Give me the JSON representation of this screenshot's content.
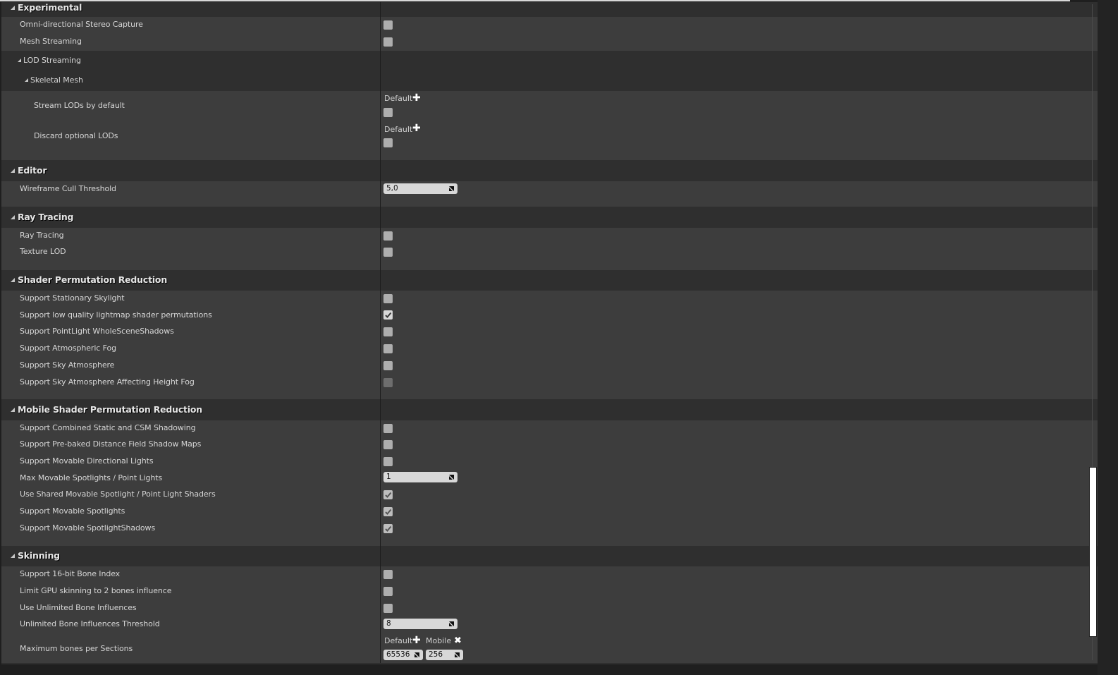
{
  "sections": {
    "experimental": {
      "title": "Experimental",
      "rows": [
        {
          "label": "Omni-directional Stereo Capture",
          "checked": false
        },
        {
          "label": "Mesh Streaming",
          "checked": false
        }
      ],
      "lod_streaming": {
        "title": "LOD Streaming",
        "skeletal_mesh": {
          "title": "Skeletal Mesh",
          "rows": [
            {
              "label": "Stream LODs by default",
              "platform_label": "Default",
              "checked": false
            },
            {
              "label": "Discard optional LODs",
              "platform_label": "Default",
              "checked": false
            }
          ]
        }
      }
    },
    "editor": {
      "title": "Editor",
      "rows": [
        {
          "label": "Wireframe Cull Threshold",
          "value": "5,0"
        }
      ]
    },
    "ray_tracing": {
      "title": "Ray Tracing",
      "rows": [
        {
          "label": "Ray Tracing",
          "checked": false
        },
        {
          "label": "Texture LOD",
          "checked": false
        }
      ]
    },
    "shader_permutation": {
      "title": "Shader Permutation Reduction",
      "rows": [
        {
          "label": "Support Stationary Skylight",
          "checked": false
        },
        {
          "label": "Support low quality lightmap shader permutations",
          "checked": true
        },
        {
          "label": "Support PointLight WholeSceneShadows",
          "checked": false
        },
        {
          "label": "Support Atmospheric Fog",
          "checked": false
        },
        {
          "label": "Support Sky Atmosphere",
          "checked": false
        },
        {
          "label": "Support Sky Atmosphere Affecting Height Fog",
          "checked": false,
          "disabled": true
        }
      ]
    },
    "mobile_shader_permutation": {
      "title": "Mobile Shader Permutation Reduction",
      "rows": [
        {
          "label": "Support Combined Static and CSM Shadowing",
          "checked": false
        },
        {
          "label": "Support Pre-baked Distance Field Shadow Maps",
          "checked": false
        },
        {
          "label": "Support Movable Directional Lights",
          "checked": false
        },
        {
          "label": "Max Movable Spotlights / Point Lights",
          "value": "1"
        },
        {
          "label": "Use Shared Movable Spotlight / Point Light Shaders",
          "checked": true
        },
        {
          "label": "Support Movable Spotlights",
          "checked": true
        },
        {
          "label": "Support Movable SpotlightShadows",
          "checked": true
        }
      ]
    },
    "skinning": {
      "title": "Skinning",
      "rows": [
        {
          "label": "Support 16-bit Bone Index",
          "checked": false
        },
        {
          "label": "Limit GPU skinning to 2 bones influence",
          "checked": false
        },
        {
          "label": "Use Unlimited Bone Influences",
          "checked": false
        },
        {
          "label": "Unlimited Bone Influences Threshold",
          "value": "8"
        },
        {
          "label": "Maximum bones per Sections",
          "default_label": "Default",
          "default_value": "65536",
          "override_label": "Mobile",
          "override_value": "256"
        }
      ]
    }
  },
  "icons": {
    "expand": "triangle-down-right",
    "add_platform": "plus",
    "remove_platform": "x",
    "spinner_drag": "diagonal-arrow"
  },
  "colors": {
    "panel_bg": "#2f2f2f",
    "row_bg": "#3d3d3d",
    "checkbox": "#aeaeae",
    "scroll_thumb": "#ffffff"
  }
}
